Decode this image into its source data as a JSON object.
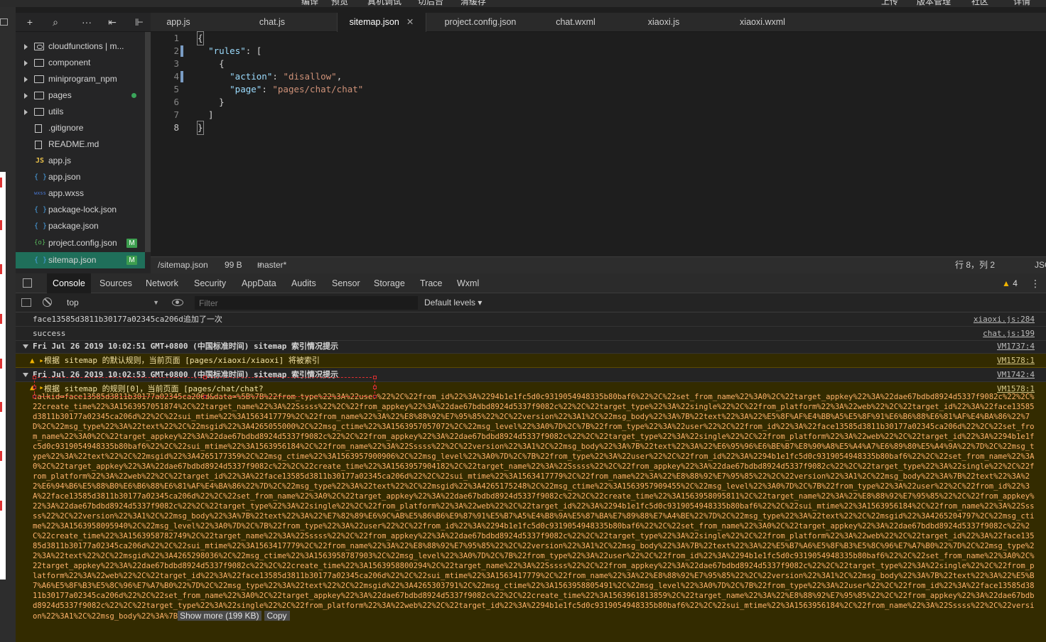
{
  "menubar": [
    "编译",
    "预览",
    "真机调试",
    "切后台",
    "清缓存",
    "上传",
    "版本管理",
    "社区",
    "详情"
  ],
  "tree_toolbar": {
    "add": "+",
    "search": "⌕",
    "more": "···",
    "sort": "⇤",
    "collapse": "⊩"
  },
  "file_tree": [
    {
      "label": "cloudfunctions | m...",
      "type": "cloud-folder"
    },
    {
      "label": "component",
      "type": "folder"
    },
    {
      "label": "miniprogram_npm",
      "type": "folder"
    },
    {
      "label": "pages",
      "type": "folder"
    },
    {
      "label": "utils",
      "type": "folder"
    },
    {
      "label": ".gitignore",
      "type": "doc"
    },
    {
      "label": "README.md",
      "type": "doc"
    },
    {
      "label": "app.js",
      "type": "js",
      "icon": "JS"
    },
    {
      "label": "app.json",
      "type": "json",
      "icon": "{ }"
    },
    {
      "label": "app.wxss",
      "type": "wxss",
      "icon": "wxss"
    },
    {
      "label": "package-lock.json",
      "type": "json",
      "icon": "{ }"
    },
    {
      "label": "package.json",
      "type": "json",
      "icon": "{ }"
    },
    {
      "label": "project.config.json",
      "type": "cfg",
      "icon": "{o}",
      "badge": "M"
    },
    {
      "label": "sitemap.json",
      "type": "json",
      "icon": "{ }",
      "badge": "M"
    }
  ],
  "tabs": [
    {
      "label": "app.js"
    },
    {
      "label": "chat.js"
    },
    {
      "label": "sitemap.json",
      "close": "✕"
    },
    {
      "label": "project.config.json"
    },
    {
      "label": "chat.wxml"
    },
    {
      "label": "xiaoxi.js"
    },
    {
      "label": "xiaoxi.wxml"
    }
  ],
  "editor": {
    "line_numbers": [
      "1",
      "2",
      "3",
      "4",
      "5",
      "6",
      "7",
      "8"
    ]
  },
  "status": {
    "path": "/sitemap.json",
    "size": "99 B",
    "branch": "master*",
    "cursor": "行 8，列 2",
    "lang": "JSON"
  },
  "devtools_tabs": [
    "Console",
    "Sources",
    "Network",
    "Security",
    "AppData",
    "Audits",
    "Sensor",
    "Storage",
    "Trace",
    "Wxml"
  ],
  "warn_count": "4",
  "console_toolbar": {
    "context": "top",
    "filter_placeholder": "Filter",
    "levels": "Default levels ▾"
  },
  "console": {
    "lines": [
      {
        "msg": "face13585d3811b30177a02345ca206d追加了一次",
        "src": "xiaoxi.js:284"
      },
      {
        "msg": "success",
        "src": "chat.js:199"
      },
      {
        "msg": "Fri Jul 26 2019 10:02:51 GMT+0800 (中国标准时间) sitemap 索引情况提示",
        "src": "VM1737:4"
      },
      {
        "msg": "根据 sitemap 的默认规则，当前页面 [pages/xiaoxi/xiaoxi] 将被索引",
        "src": "VM1578:1"
      },
      {
        "msg": "Fri Jul 26 2019 10:02:53 GMT+0800 (中国标准时间) sitemap 索引情况提示",
        "src": "VM1742:4"
      }
    ],
    "warn_head": "根据 sitemap 的规则[0]，当前页面 [pages/chat/chat?",
    "warn_src": "VM1578:1",
    "warn_body": "talkid=face13585d3811b30177a02345ca206d&data=%5B%7B%22from_type%22%3A%22user%22%2C%22from_id%22%3A%2294b1e1fc5d0c9319054948335b80baf6%22%2C%22set_from_name%22%3A0%2C%22target_appkey%22%3A%22dae67bdbd8924d5337f9082c%22%2C%22create_time%22%3A1563957051874%2C%22target_name%22%3A%22Sssss%22%2C%22from_appkey%22%3A%22dae67bdbd8924d5337f9082c%22%2C%22target_type%22%3A%22single%22%2C%22from_platform%22%3A%22web%22%2C%22target_id%22%3A%22face13585d3811b30177a02345ca206d%22%2C%22sui_mtime%22%3A1563417779%2C%22from_name%22%3A%22%E8%88%92%E7%95%85%22%2C%22version%22%3A1%2C%22msg_body%22%3A%7B%22text%22%3A%22%E5%8F%AF%E4%BB%A5%E5%8F%91%E6%B6%88%E6%81%AF%E4%BA%86%22%7D%2C%22msg_type%22%3A%22text%22%2C%22msgid%22%3A4265055000%2C%22msg_ctime%22%3A1563957057072%2C%22msg_level%22%3A0%7D%2C%7B%22from_type%22%3A%22user%22%2C%22from_id%22%3A%22face13585d3811b30177a02345ca206d%22%2C%22set_from_name%22%3A0%2C%22target_appkey%22%3A%22dae67bdbd8924d5337f9082c%22%2C%22from_appkey%22%3A%22dae67bdbd8924d5337f9082c%22%2C%22target_type%22%3A%22single%22%2C%22from_platform%22%3A%22web%22%2C%22target_id%22%3A%2294b1e1fc5d0c9319054948335b80baf6%22%2C%22sui_mtime%22%3A1563956184%2C%22from_name%22%3A%22Sssss%22%2C%22version%22%3A1%2C%22msg_body%22%3A%7B%22text%22%3A%22%E6%95%96%E6%BE%B7%E8%90%A8%E5%A4%A7%E6%89%80%E5%A4%9A%22%7D%2C%22msg_type%22%3A%22text%22%2C%22msgid%22%3A4265177359%2C%22msg_ctime%22%3A1563957900906%2C%22msg_level%22%3A0%7D%2C%7B%22from_type%22%3A%22user%22%2C%22from_id%22%3A%2294b1e1fc5d0c9319054948335b80baf6%22%2C%22set_from_name%22%3A0%2C%22target_appkey%22%3A%22dae67bdbd8924d5337f9082c%22%2C%22create_time%22%3A1563957904182%2C%22target_name%22%3A%22Sssss%22%2C%22from_appkey%22%3A%22dae67bdbd8924d5337f9082c%22%2C%22target_type%22%3A%22single%22%2C%22from_platform%22%3A%22web%22%2C%22target_id%22%3A%22face13585d3811b30177a02345ca206d%22%2C%22sui_mtime%22%3A1563417779%2C%22from_name%22%3A%22%E8%88%92%E7%95%85%22%2C%22version%22%3A1%2C%22msg_body%22%3A%7B%22text%22%3A%22%E6%94%B6%E5%88%B0%E6%B6%88%E6%81%AF%E4%BA%86%22%7D%2C%22msg_type%22%3A%22text%22%2C%22msgid%22%3A4265175248%2C%22msg_ctime%22%3A1563957909455%2C%22msg_level%22%3A0%7D%2C%7B%22from_type%22%3A%22user%22%2C%22from_id%22%3A%22face13585d3811b30177a02345ca206d%22%2C%22set_from_name%22%3A0%2C%22target_appkey%22%3A%22dae67bdbd8924d5337f9082c%22%2C%22create_time%22%3A1563958095811%2C%22target_name%22%3A%22%E8%88%92%E7%95%85%22%2C%22from_appkey%22%3A%22dae67bdbd8924d5337f9082c%22%2C%22target_type%22%3A%22single%22%2C%22from_platform%22%3A%22web%22%2C%22target_id%22%3A%2294b1e1fc5d0c9319054948335b80baf6%22%2C%22sui_mtime%22%3A1563956184%2C%22from_name%22%3A%22Sssss%22%2C%22version%22%3A1%2C%22msg_body%22%3A%7B%22text%22%3A%22%E7%82%89%E6%9C%AB%E5%86%B6%E9%87%91%E5%B7%A5%E4%B8%9A%E5%87%BA%E7%89%88%E7%A4%BE%22%7D%2C%22msg_type%22%3A%22text%22%2C%22msgid%22%3A4265204797%2C%22msg_ctime%22%3A1563958095940%2C%22msg_level%22%3A0%7D%2C%7B%22from_type%22%3A%22user%22%2C%22from_id%22%3A%2294b1e1fc5d0c9319054948335b80baf6%22%2C%22set_from_name%22%3A0%2C%22target_appkey%22%3A%22dae67bdbd8924d5337f9082c%22%2C%22create_time%22%3A1563958782749%2C%22target_name%22%3A%22Sssss%22%2C%22from_appkey%22%3A%22dae67bdbd8924d5337f9082c%22%2C%22target_type%22%3A%22single%22%2C%22from_platform%22%3A%22web%22%2C%22target_id%22%3A%22face13585d3811b30177a02345ca206d%22%2C%22sui_mtime%22%3A1563417779%2C%22from_name%22%3A%22%E8%88%92%E7%95%85%22%2C%22version%22%3A1%2C%22msg_body%22%3A%7B%22text%22%3A%22%E5%B7%A6%E5%8F%B3%E5%8C%96%E7%A7%B0%22%7D%2C%22msg_type%22%3A%22text%22%2C%22msgid%22%3A4265298036%2C%22msg_ctime%22%3A1563958787903%2C%22msg_level%22%3A0%7D%2C%7B%22from_type%22%3A%22user%22%2C%22from_id%22%3A%2294b1e1fc5d0c9319054948335b80baf6%22%2C%22set_from_name%22%3A0%2C%22target_appkey%22%3A%22dae67bdbd8924d5337f9082c%22%2C%22create_time%22%3A1563958800294%2C%22target_name%22%3A%22Sssss%22%2C%22from_appkey%22%3A%22dae67bdbd8924d5337f9082c%22%2C%22target_type%22%3A%22single%22%2C%22from_platform%22%3A%22web%22%2C%22target_id%22%3A%22face13585d3811b30177a02345ca206d%22%2C%22sui_mtime%22%3A1563417779%2C%22from_name%22%3A%22%E8%88%92%E7%95%85%22%2C%22version%22%3A1%2C%22msg_body%22%3A%7B%22text%22%3A%22%E5%B7%A6%E5%8F%B3%E5%8C%96%E7%A7%B0%22%7D%2C%22msg_type%22%3A%22text%22%2C%22msgid%22%3A4265303791%2C%22msg_ctime%22%3A1563958805491%2C%22msg_level%22%3A0%7D%2C%7B%22from_type%22%3A%22user%22%2C%22from_id%22%3A%22face13585d3811b30177a02345ca206d%22%2C%22set_from_name%22%3A0%2C%22target_appkey%22%3A%22dae67bdbd8924d5337f9082c%22%2C%22create_time%22%3A1563961813859%2C%22target_name%22%3A%22%E8%88%92%E7%95%85%22%2C%22from_appkey%22%3A%22dae67bdbd8924d5337f9082c%22%2C%22target_type%22%3A%22single%22%2C%22from_platform%22%3A%22web%22%2C%22target_id%22%3A%2294b1e1fc5d0c9319054948335b80baf6%22%2C%22sui_mtime%22%3A1563956184%2C%22from_name%22%3A%22Sssss%22%2C%22version%22%3A1%2C%22msg_body%22%3A%7B",
    "show_more": "Show more (199 KB)",
    "copy": "Copy"
  },
  "colors": {
    "accent_selected": "#1f6f5a",
    "warn_bg": "#332b00",
    "warn_text": "#ffb36b",
    "badge": "#3d9e4f"
  }
}
